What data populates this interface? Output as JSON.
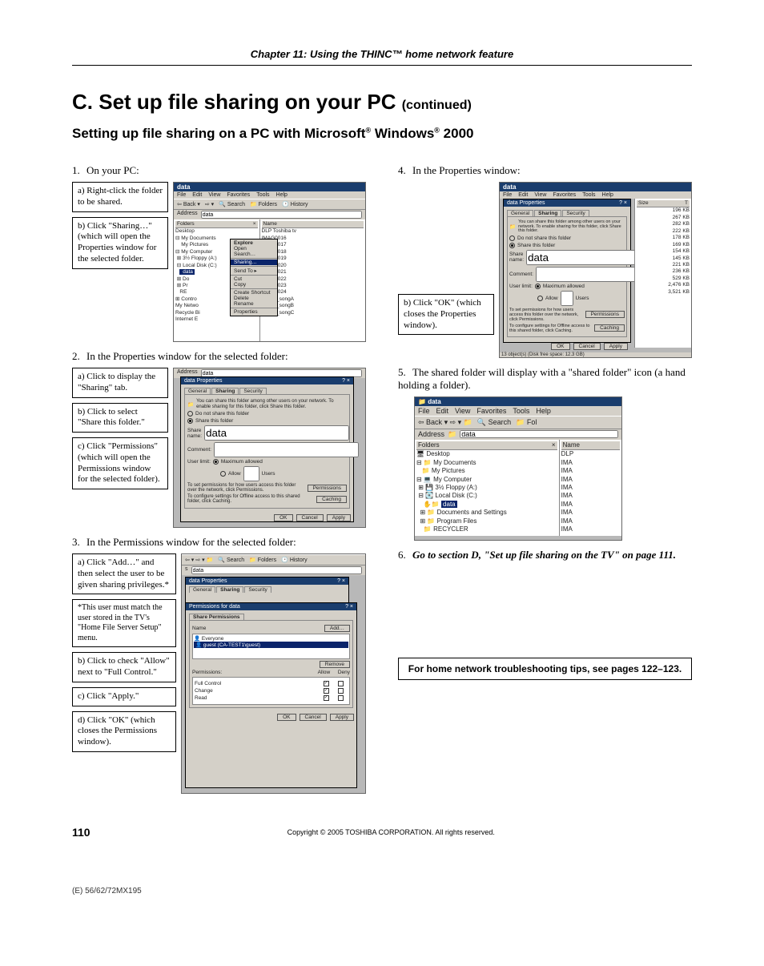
{
  "chapter": "Chapter 11: Using the THINC™ home network feature",
  "title_main": "C.  Set up file sharing on your PC ",
  "title_cont": "(continued)",
  "subtitle_a": "Setting up file sharing on a PC with Microsoft",
  "subtitle_b": " Windows",
  "subtitle_c": " 2000",
  "reg": "®",
  "steps": {
    "s1": "On your PC:",
    "s2": "In the Properties window for the selected folder:",
    "s3": "In the Permissions window for the selected folder:",
    "s4": "In the Properties window:",
    "s5": "The shared folder will display with a \"shared folder\" icon (a hand holding a folder).",
    "s6": "Go to section D, \"Set up file sharing on the TV\" on page 111."
  },
  "labels": {
    "l1a": "a) Right-click the folder to be shared.",
    "l1b": "b) Click \"Sharing…\" (which will open the Properties window for the selected folder.",
    "l2a": "a) Click to display the \"Sharing\" tab.",
    "l2b": "b) Click to select \"Share this folder.\"",
    "l2c": "c) Click \"Permissions\" (which will open the Permissions window for the selected folder).",
    "l3a": "a) Click \"Add…\" and then select the user to be given sharing privileges.*",
    "l3note": "*This user must match the user stored in the TV's \"Home File Server Setup\" menu.",
    "l3b": "b) Click to check \"Allow\" next to \"Full Control.\"",
    "l3c": "c) Click \"Apply.\"",
    "l3d": "d) Click \"OK\" (which closes the Permissions window).",
    "l4b": "b) Click \"OK\" (which closes the Properties window)."
  },
  "win": {
    "title": "data",
    "menus": [
      "File",
      "Edit",
      "View",
      "Favorites",
      "Tools",
      "Help"
    ],
    "back": "Back",
    "search": "Search",
    "folders": "Folders",
    "history": "History",
    "address": "Address",
    "addr_val": "data",
    "folders_hdr": "Folders",
    "name_hdr": "Name",
    "size_hdr": "Size",
    "tree": [
      "Desktop",
      " My Documents",
      "  My Pictures",
      " My Computer",
      "  3½ Floppy (A:)",
      "  Local Disk (C:)",
      "   data",
      "   Documents and Settings",
      "   Program Files",
      "   RECYCLER"
    ],
    "files": [
      "DLP Toshiba tv",
      "IMAG0016",
      "IMAG0017",
      "IMAG0018",
      "IMAG0019",
      "IMAG0020",
      "IMAG0021",
      "IMAG0022",
      "IMAG0023",
      "IMAG0024",
      "Artist1_songA",
      "Artist2_songB",
      "Artist3_songC"
    ],
    "sizes": [
      "196 KB",
      "267 KB",
      "282 KB",
      "222 KB",
      "178 KB",
      "169 KB",
      "154 KB",
      "145 KB",
      "221 KB",
      "236 KB",
      "529 KB",
      "2,476 KB",
      "3,521 KB"
    ],
    "files5": [
      "DLP",
      "IMA",
      "IMA",
      "IMA",
      "IMA",
      "IMA",
      "IMA",
      "IMA",
      "IMA",
      "IMA"
    ],
    "status4": "13 object(s) (Disk free space: 12.3 GB)"
  },
  "ctx": {
    "explore": "Explore",
    "open": "Open",
    "search": "Search…",
    "sharing": "Sharing…",
    "sendto": "Send To",
    "cut": "Cut",
    "copy": "Copy",
    "shortcut": "Create Shortcut",
    "delete": "Delete",
    "rename": "Rename",
    "props": "Properties"
  },
  "propdlg": {
    "title": "data Properties",
    "tabs": [
      "General",
      "Sharing",
      "Security"
    ],
    "desc": "You can share this folder among other users on your network. To enable sharing for this folder, click Share this folder.",
    "opt1": "Do not share this folder",
    "opt2": "Share this folder",
    "shname": "Share name:",
    "shval": "data",
    "comment": "Comment:",
    "ulimit": "User limit:",
    "max": "Maximum allowed",
    "allow": "Allow",
    "users": "Users",
    "perm_txt": "To set permissions for how users access this folder over the network, click Permissions.",
    "perm_btn": "Permissions",
    "cache_txt": "To configure settings for Offline access to this shared folder, click Caching.",
    "cache_btn": "Caching",
    "ok": "OK",
    "cancel": "Cancel",
    "apply": "Apply"
  },
  "permdlg": {
    "title": "Permissions for data",
    "tab": "Share Permissions",
    "name": "Name",
    "add": "Add…",
    "remove": "Remove",
    "everyone": "Everyone",
    "guest": "guest (CA-TEST1\\guest)",
    "perms_hdr": "Permissions:",
    "allow": "Allow",
    "deny": "Deny",
    "fc": "Full Control",
    "chg": "Change",
    "rd": "Read",
    "ok": "OK",
    "cancel": "Cancel",
    "apply": "Apply"
  },
  "tips": "For home network troubleshooting tips, see pages 122–123.",
  "page_num": "110",
  "copyright": "Copyright © 2005 TOSHIBA CORPORATION. All rights reserved.",
  "model": "(E) 56/62/72MX195"
}
